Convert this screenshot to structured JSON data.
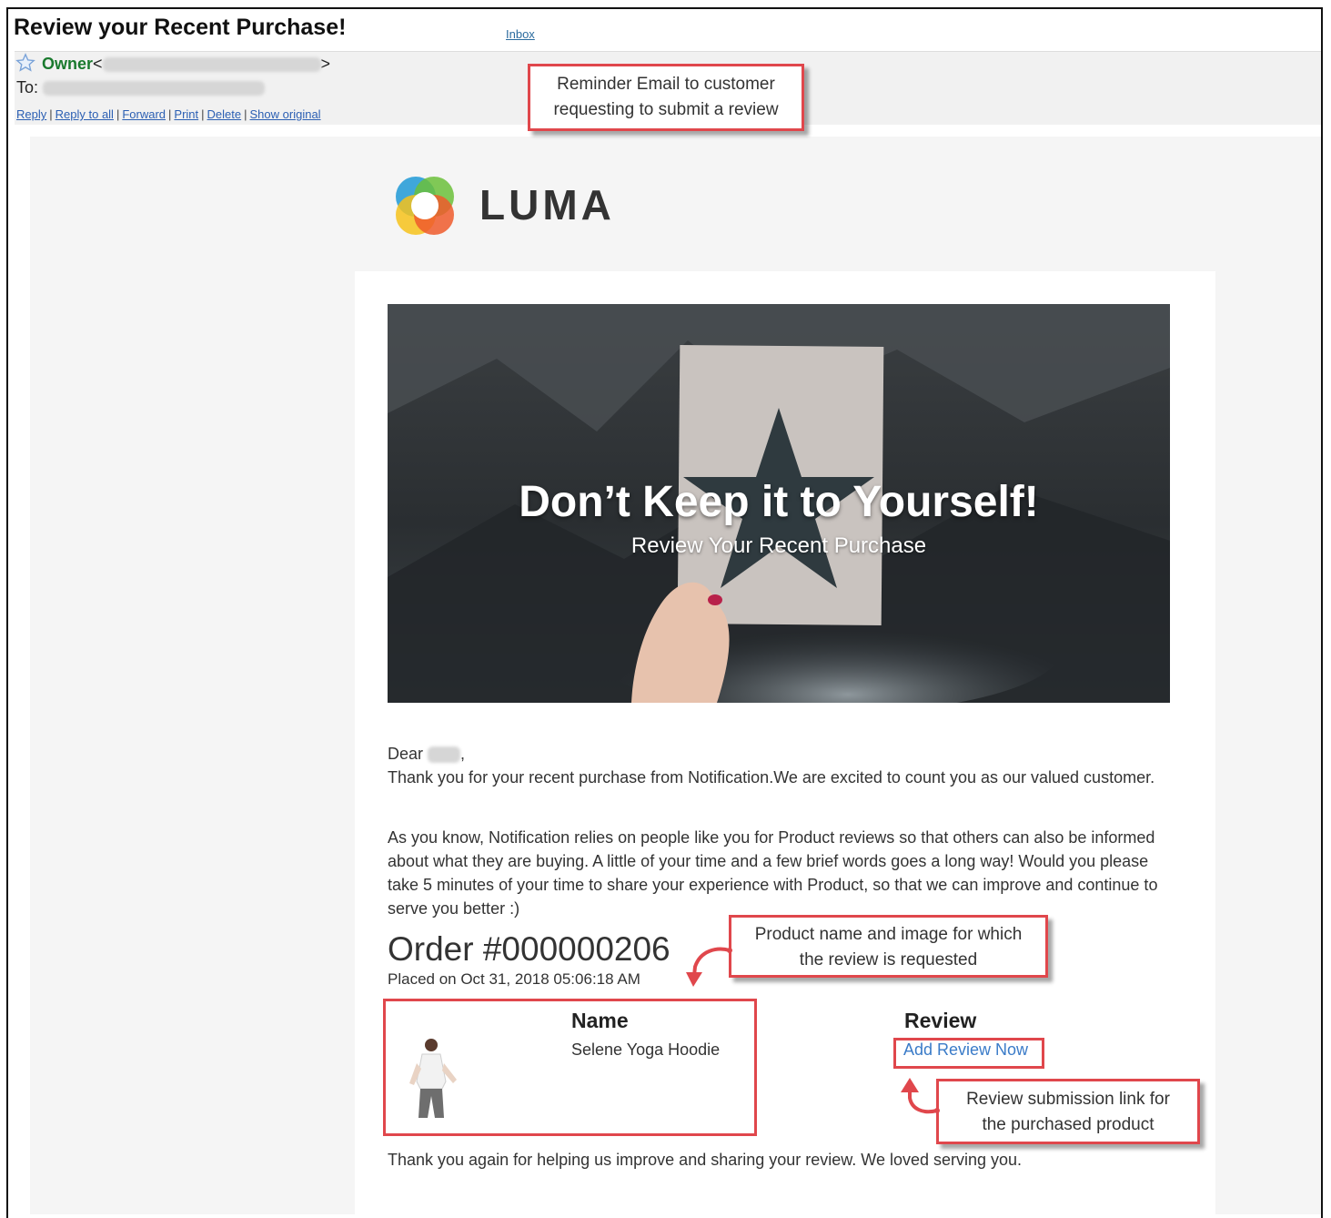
{
  "email": {
    "subject": "Review your Recent Purchase!",
    "inbox_label": "Inbox",
    "from_label": "Owner",
    "from_open": "<",
    "from_close": ">",
    "to_label": "To:",
    "actions": [
      "Reply",
      "Reply to all",
      "Forward",
      "Print",
      "Delete",
      "Show original"
    ]
  },
  "callouts": {
    "reminder": [
      "Reminder Email to customer",
      "requesting to submit a review"
    ],
    "product": [
      "Product name and image for which",
      "the review is requested"
    ],
    "review_link": [
      "Review submission link for",
      "the purchased product"
    ]
  },
  "content": {
    "brand": "LUMA",
    "hero_title": "Don’t Keep it to Yourself!",
    "hero_subtitle": "Review Your Recent Purchase",
    "greeting": "Dear",
    "greeting_end": ",",
    "paragraph1": "Thank you for your recent purchase from Notification.We are excited to count you as our valued customer.",
    "paragraph2": "As you know, Notification relies on people like you for Product reviews so that others can also be informed about what they are buying. A little of your time and a few brief words goes a long way! Would you please take 5 minutes of your time to share your experience with Product, so that we can improve and continue to serve you better :)",
    "order_title": "Order #000000206",
    "placed": "Placed on Oct 31, 2018 05:06:18 AM",
    "name_header": "Name",
    "product_name": "Selene Yoga Hoodie",
    "review_header": "Review",
    "review_link": "Add Review Now",
    "closing": "Thank you again for helping us improve and sharing your review. We loved serving you."
  },
  "colors": {
    "callout_border": "#e0474c",
    "link": "#2b5fb3",
    "sender_green": "#1a7a2e"
  }
}
